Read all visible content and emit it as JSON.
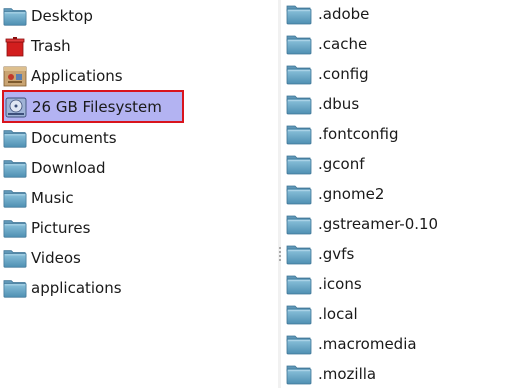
{
  "sidebar": {
    "items": [
      {
        "label": "Desktop",
        "icon": "folder-icon"
      },
      {
        "label": "Trash",
        "icon": "trash-icon"
      },
      {
        "label": "Applications",
        "icon": "applications-icon"
      },
      {
        "label": "26 GB Filesystem",
        "icon": "hard-drive-icon",
        "selected": true
      },
      {
        "label": "Documents",
        "icon": "folder-icon"
      },
      {
        "label": "Download",
        "icon": "folder-icon"
      },
      {
        "label": "Music",
        "icon": "folder-icon"
      },
      {
        "label": "Pictures",
        "icon": "folder-icon"
      },
      {
        "label": "Videos",
        "icon": "folder-icon"
      },
      {
        "label": "applications",
        "icon": "folder-icon"
      }
    ]
  },
  "files": {
    "items": [
      {
        "label": ".adobe"
      },
      {
        "label": ".cache"
      },
      {
        "label": ".config"
      },
      {
        "label": ".dbus"
      },
      {
        "label": ".fontconfig"
      },
      {
        "label": ".gconf"
      },
      {
        "label": ".gnome2"
      },
      {
        "label": ".gstreamer-0.10"
      },
      {
        "label": ".gvfs"
      },
      {
        "label": ".icons"
      },
      {
        "label": ".local"
      },
      {
        "label": ".macromedia"
      },
      {
        "label": ".mozilla"
      }
    ]
  },
  "colors": {
    "selection_bg": "#b3b3f2",
    "selection_border": "#d9141d",
    "folder_body": "#6aa9c9",
    "folder_tab": "#4d8fb3"
  }
}
